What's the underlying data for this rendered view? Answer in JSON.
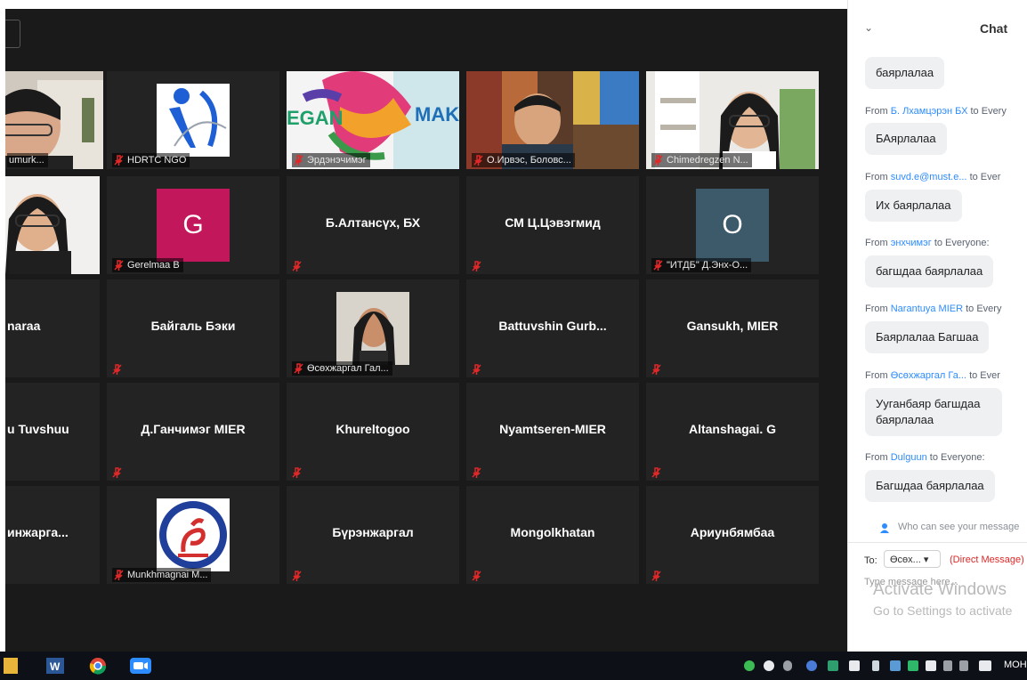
{
  "chat": {
    "title": "Chat",
    "messages": [
      {
        "from": "",
        "name": "",
        "to": "",
        "text": "баярлалаа"
      },
      {
        "from": "From",
        "name": "Б. Лхамцэрэн БХ",
        "to": "to Every",
        "text": "БАярлалаа"
      },
      {
        "from": "From",
        "name": "suvd.e@must.e...",
        "to": "to Ever",
        "text": "Их баярлалаа"
      },
      {
        "from": "From",
        "name": "энхчимэг",
        "to": "to Everyone:",
        "text": "багшдаа баярлалаа"
      },
      {
        "from": "From",
        "name": "Narantuya MIER",
        "to": "to Every",
        "text": "Баярлалаа Багшаа"
      },
      {
        "from": "From",
        "name": "Өсөхжаргал Га...",
        "to": "to Ever",
        "text": "Ууганбаяр багшдаа баярлалаа"
      },
      {
        "from": "From",
        "name": "Dulguun",
        "to": "to Everyone:",
        "text": "Багшдаа баярлалаа"
      }
    ],
    "who_can_see": "Who can see your message",
    "to_label": "To:",
    "to_value": "Өсөх...",
    "direct_message": "(Direct Message)",
    "placeholder": "Type message here...",
    "watermark_1": "Activate Windows",
    "watermark_2": "Go to Settings to activate"
  },
  "participants": [
    "umurk...",
    "HDRTC NGO",
    "Эрдэнэчимэг",
    "О.Ирвэс, Боловс...",
    "Chimedregzen N...",
    "",
    "Gerelmaa B",
    "Б.Алтансүх, БХ",
    "СМ Ц.Цэвэгмид",
    "\"ИТДБ\" Д.Энх-О...",
    "naraa",
    "Байгаль Бэки",
    "Өсөхжаргал Гал...",
    "Battuvshin  Gurb...",
    "Gansukh, MIER",
    "u Tuvshuu",
    "Д.Ганчимэг MIER",
    "Khureltogoo",
    "Nyamtseren-MIER",
    "Altanshagai. G",
    "инжарга...",
    "Munkhmagnai M...",
    "Бүрэнжаргал",
    "Mongolkhatan",
    "Ариунбямбаа"
  ],
  "avatars": {
    "gerelmaa": "G",
    "itdb": "O"
  },
  "banner": {
    "left": "EGAN",
    "right": "MAKE"
  },
  "colors": {
    "active_speaker": "#c7e33a",
    "mic_muted": "#e02828",
    "link": "#2d8cff"
  },
  "taskbar": {
    "lang": "МОН"
  }
}
